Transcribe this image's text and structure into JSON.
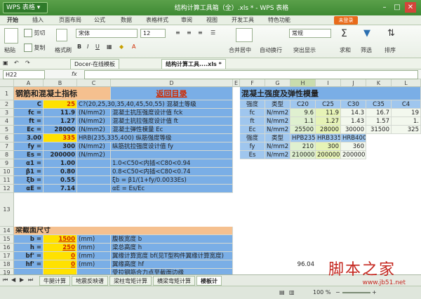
{
  "app": {
    "name": "WPS 表格",
    "title": "结构计算工具箱（全）.xls * - WPS 表格"
  },
  "menu": [
    "开始",
    "插入",
    "页面布局",
    "公式",
    "数据",
    "表格样式",
    "审阅",
    "视图",
    "开发工具",
    "特色功能"
  ],
  "login_label": "未登录",
  "ribbon": {
    "cut": "剪切",
    "copy": "复制",
    "format_painter": "格式刷",
    "paste": "粘贴",
    "font_name": "宋体",
    "font_size": "12",
    "merge_center": "合并居中",
    "wrap_text": "自动换行",
    "general": "常规",
    "highlight": "突出显示",
    "sum": "求和",
    "filter": "筛选",
    "sort": "排序"
  },
  "doc_tabs": [
    "Docer-在线模板",
    "结构计算工具....xls *"
  ],
  "formula_bar": {
    "cell_ref": "H22",
    "fx": "fx",
    "value": ""
  },
  "columns": [
    "A",
    "B",
    "C",
    "D",
    "E",
    "F",
    "G",
    "H",
    "I",
    "J",
    "K",
    "L"
  ],
  "left_table": {
    "title": "钢筋和混凝土指标",
    "back_link": "返回目录",
    "rows": [
      {
        "row": "2",
        "a": "C",
        "b": "25",
        "c": "C?(20,25,30,35,40,45,50,55) 混凝土等级"
      },
      {
        "row": "3",
        "a": "fc =",
        "b": "11.9",
        "c": "(N/mm2)",
        "d": "混凝土抗压强度设计值 fck"
      },
      {
        "row": "4",
        "a": "ft =",
        "b": "1.27",
        "c": "(N/mm2)",
        "d": "混凝土抗拉强度设计值 ft"
      },
      {
        "row": "5",
        "a": "Ec =",
        "b": "28000",
        "c": "(N/mm2)",
        "d": "混凝土弹性模量 Ec"
      },
      {
        "row": "6",
        "a": "3.00",
        "b": "335",
        "c": "HRB(235,335,400) 纵筋强度等级"
      },
      {
        "row": "7",
        "a": "fy =",
        "b": "300",
        "c": "(N/mm2)",
        "d": "纵筋抗拉强度设计值 fy"
      },
      {
        "row": "8",
        "a": "Es =",
        "b": "200000",
        "c": "(N/mm2)",
        "d": ""
      },
      {
        "row": "9",
        "a": "α1 =",
        "b": "1.00",
        "c": "",
        "d": "1.0<C50<内插<C80<0.94"
      },
      {
        "row": "10",
        "a": "β1 =",
        "b": "0.80",
        "c": "",
        "d": "0.8<C50<内插<C80<0.74"
      },
      {
        "row": "11",
        "a": "ξb =",
        "b": "0.55",
        "c": "",
        "d": "ξb = β1/(1+fy/0.0033Es)"
      },
      {
        "row": "12",
        "a": "αE =",
        "b": "7.14",
        "c": "",
        "d": "αE = Es/Ec"
      }
    ]
  },
  "right_table": {
    "title": "混凝土强度及弹性模量",
    "header": [
      "强度",
      "类型",
      "C20",
      "C25",
      "C30",
      "C35",
      "C4"
    ],
    "rows": [
      [
        "fc",
        "N/mm2",
        "9.6",
        "11.9",
        "14.3",
        "16.7",
        "19"
      ],
      [
        "ft",
        "N/mm2",
        "1.1",
        "1.27",
        "1.43",
        "1.57",
        "1."
      ],
      [
        "Ec",
        "N/mm2",
        "25500",
        "28000",
        "30000",
        "31500",
        "325"
      ]
    ],
    "steel_header": [
      "强度",
      "类型",
      "HPB235",
      "HRB335",
      "HRB400"
    ],
    "steel_rows": [
      [
        "fy",
        "N/mm2",
        "210",
        "300",
        "360"
      ],
      [
        "Es",
        "N/mm2",
        "210000",
        "200000",
        "200000"
      ]
    ]
  },
  "section_table": {
    "title": "梁截面尺寸",
    "rows": [
      {
        "row": "15",
        "a": "b =",
        "b": "1500",
        "c": "(mm)",
        "d": "腹板宽度 b"
      },
      {
        "row": "16",
        "a": "h =",
        "b": "250",
        "c": "(mm)",
        "d": "梁总高度 h"
      },
      {
        "row": "17",
        "a": "bf' =",
        "b": "0",
        "c": "(mm)",
        "d": "翼缘计算宽度 bf(见T型构件翼缘计算宽度)"
      },
      {
        "row": "18",
        "a": "hf' =",
        "b": "0",
        "c": "(mm)",
        "d": "翼缘高度 hf"
      },
      {
        "row": "19",
        "a": "",
        "b": "",
        "c": "",
        "d": "受拉钢筋合力点至截面边缘"
      }
    ],
    "extra_value": "96.04"
  },
  "row_numbers": [
    "1",
    "2",
    "3",
    "4",
    "5",
    "6",
    "7",
    "8",
    "9",
    "10",
    "11",
    "12",
    "13",
    "14",
    "15",
    "16",
    "17",
    "18",
    "19"
  ],
  "sheet_tabs": [
    "牛腿计算",
    "地震反映谱",
    "梁柱弯矩计算",
    "横梁弯矩计算",
    "楼板计"
  ],
  "status": {
    "zoom": "100 %"
  },
  "watermark": {
    "text": "脚本之家",
    "url": "www.jb51.net"
  }
}
